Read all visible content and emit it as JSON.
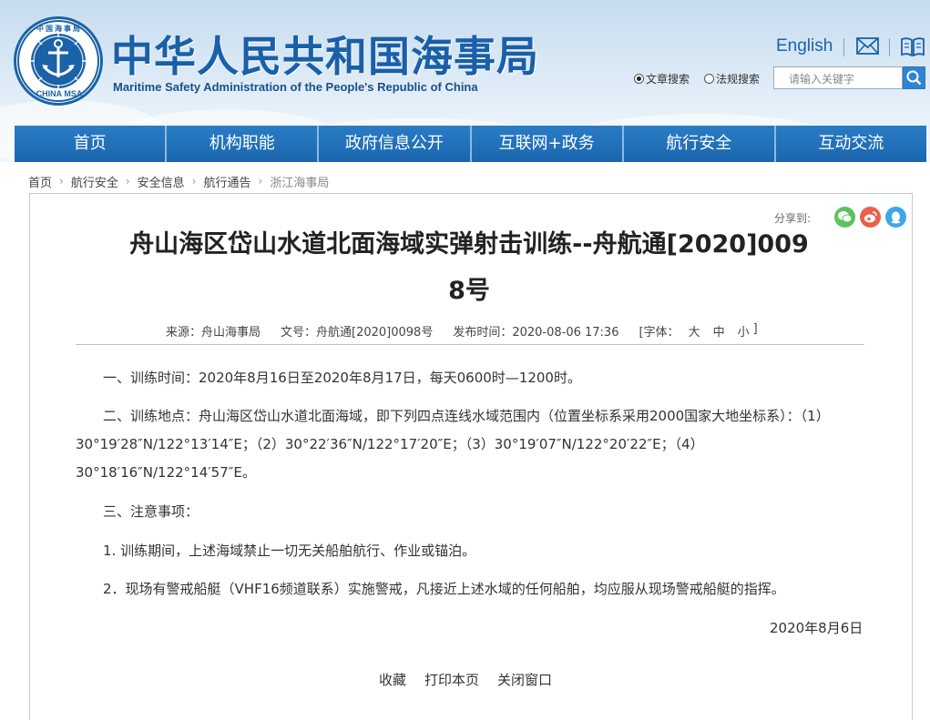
{
  "header": {
    "site_title": "中华人民共和国海事局",
    "site_subtitle": "Maritime Safety Administration of the People's Republic of China",
    "logo_text_top": "中国海事局",
    "logo_text_bottom": "CHINA MSA",
    "english_link": "English",
    "search": {
      "radio_article": "文章搜索",
      "radio_law": "法规搜索",
      "placeholder": "请输入关键字"
    }
  },
  "nav": {
    "items": [
      {
        "label": "首页"
      },
      {
        "label": "机构职能"
      },
      {
        "label": "政府信息公开"
      },
      {
        "label": "互联网+政务"
      },
      {
        "label": "航行安全"
      },
      {
        "label": "互动交流"
      }
    ]
  },
  "breadcrumb": {
    "items": [
      "首页",
      "航行安全",
      "安全信息",
      "航行通告",
      "浙江海事局"
    ]
  },
  "share": {
    "label": "分享到:",
    "icons": [
      {
        "name": "wechat",
        "color": "#5bc35b"
      },
      {
        "name": "weibo",
        "color": "#e9604c"
      },
      {
        "name": "qq",
        "color": "#3ba7ea"
      }
    ]
  },
  "article": {
    "title": "舟山海区岱山水道北面海域实弹射击训练--舟航通[2020]0098号",
    "meta": {
      "source": "来源：舟山海事局",
      "doc_no": "文号：舟航通[2020]0098号",
      "publish_time": "发布时间：2020-08-06 17:36",
      "font_label": "[字体：",
      "font_large": "大",
      "font_medium": "中",
      "font_small": "小",
      "font_end": "]"
    },
    "paragraphs": [
      "一、训练时间：2020年8月16日至2020年8月17日，每天0600时—1200时。",
      "二、训练地点：舟山海区岱山水道北面海域，即下列四点连线水域范围内（位置坐标系采用2000国家大地坐标系）：（1）30°19′28″N/122°13′14″E；（2）30°22′36″N/122°17′20″E；（3）30°19′07″N/122°20′22″E；（4）30°18′16″N/122°14′57″E。",
      "三、注意事项：",
      "1. 训练期间，上述海域禁止一切无关船舶航行、作业或锚泊。",
      "2．现场有警戒船艇（VHF16频道联系）实施警戒，凡接近上述水域的任何船舶，均应服从现场警戒船艇的指挥。"
    ],
    "date": "2020年8月6日",
    "footer_links": [
      "收藏",
      "打印本页",
      "关闭窗口"
    ]
  }
}
